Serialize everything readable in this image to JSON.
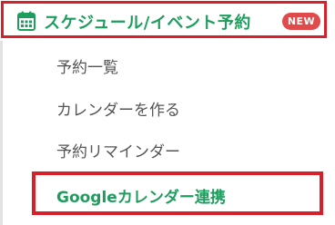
{
  "header": {
    "title": "スケジュール/イベント予約",
    "badge": "NEW",
    "icon": "calendar-icon"
  },
  "menu": {
    "items": [
      {
        "label": "予約一覧"
      },
      {
        "label": "カレンダーを作る"
      },
      {
        "label": "予約リマインダー"
      },
      {
        "label": "Googleカレンダー連携"
      }
    ]
  },
  "colors": {
    "accent_green": "#1e9e5e",
    "highlight_red": "#d8202a",
    "badge_red": "#e04a4a",
    "text_gray": "#555555"
  }
}
